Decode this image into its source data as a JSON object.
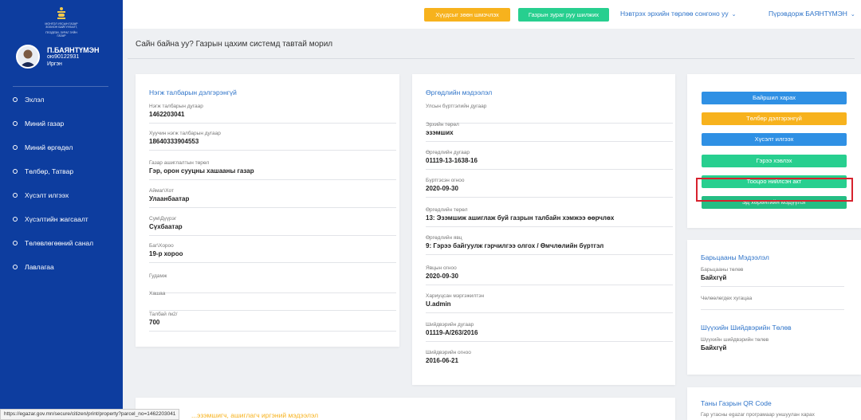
{
  "sidebar": {
    "logo_text": [
      "МОНГОЛ УЛСЫН ГАЗАР ЗОХИОН БАЙГУУЛАЛТ,",
      "ГЕОДЕЗИ, ЗУРАГ ЗҮЙН ГАЗАР"
    ],
    "user": {
      "name": "П.БАЯНТҮМЭН",
      "id": "ою90122931",
      "role": "Иргэн"
    },
    "items": [
      {
        "label": "Эхлэл"
      },
      {
        "label": "Миний газар"
      },
      {
        "label": "Миний өргөдөл"
      },
      {
        "label": "Төлбөр, Татвар"
      },
      {
        "label": "Хүсэлт илгээх"
      },
      {
        "label": "Хүсэлтийн жагсаалт"
      },
      {
        "label": "Төлөвлөгөөний санал"
      },
      {
        "label": "Лавлагаа"
      }
    ]
  },
  "topbar": {
    "request_btn": "Хүүдсыг зөөн шмэчлэх",
    "map_btn": "Газрын зураг руу шилжих",
    "role_select": "Нэвтрэх эрхийн төрлөө сонгоно уу",
    "user_menu": "Пүрэвдорж БАЯНТҮМЭН"
  },
  "welcome": "Сайн байна уу? Газрын цахим системд тавтай морил",
  "parcel": {
    "title": "Нэгж талбарын дэлгэрэнгүй",
    "fields": [
      {
        "label": "Нэгж талбарын дугаар",
        "value": "1462203041"
      },
      {
        "label": "Хуучин нэгж талбарын дугаар",
        "value": "18640333904553"
      },
      {
        "label": "Газар ашиглалтын төрөл",
        "value": "Гэр, орон сууцны хашааны газар"
      },
      {
        "label": "Аймаг\\Хот",
        "value": "Улаанбаатар"
      },
      {
        "label": "Сум\\Дүүрэг",
        "value": "Сүхбаатар"
      },
      {
        "label": "Баг\\Хороо",
        "value": "19-р хороо"
      },
      {
        "label": "Гудамж",
        "value": ""
      },
      {
        "label": "Хашаа",
        "value": ""
      },
      {
        "label": "Талбай /м2/",
        "value": "700"
      }
    ]
  },
  "application": {
    "title": "Өргөдлийн мэдээлэл",
    "fields": [
      {
        "label": "Улсын бүртгэлийн дугаар",
        "value": ""
      },
      {
        "label": "Эрхийн төрөл",
        "value": "эзэмших"
      },
      {
        "label": "Өргөдлийн дугаар",
        "value": "01119-13-1638-16"
      },
      {
        "label": "Бүртгэсэн огноо",
        "value": "2020-09-30"
      },
      {
        "label": "Өргөдлийн төрөл",
        "value": "13: Эзэмшиж ашиглаж буй газрын талбайн хэмжээ өөрчлөх"
      },
      {
        "label": "Өргөдлийн явц",
        "value": "9: Гэрээ байгуулж гэрчилгээ олгох / Өмчлөлийн бүртгэл"
      },
      {
        "label": "Явцын огноо",
        "value": "2020-09-30"
      },
      {
        "label": "Хариуцсан мэргэжилтэн",
        "value": "U.admin"
      },
      {
        "label": "Шийдвэрийн дугаар",
        "value": "01119-А/263/2016"
      },
      {
        "label": "Шийдвэрийн огноо",
        "value": "2016-06-21"
      }
    ]
  },
  "actions": [
    {
      "label": "Байршил харах",
      "color": "blue"
    },
    {
      "label": "Төлбөр дэлгэрэнгүй",
      "color": "orange"
    },
    {
      "label": "Хүсэлт илгээх",
      "color": "blue"
    },
    {
      "label": "Гэрээ хэвлэх",
      "color": "green"
    },
    {
      "label": "Тооцоо нийлсэн акт",
      "color": "green"
    },
    {
      "label": "Эд хөрөнгийн мэдүүлэг",
      "color": "green"
    }
  ],
  "mortgage": {
    "title": "Барьцааны Мэдээлэл",
    "status_label": "Барьцааны төлөв",
    "status_value": "Байхгүй",
    "expiry_label": "Чөлөөлөгдөх хугацаа"
  },
  "court": {
    "title": "Шүүхийн Шийдвэрийн Төлөв",
    "status_label": "Шүүхийн шийдвэрийн төлөв",
    "status_value": "Байхгүй"
  },
  "qr": {
    "title": "Таны Газрын QR Code",
    "hint": "Гар утасны egazar програмаар уншуулан харах"
  },
  "bottom_card_title": "...эзэмшигч, ашиглагч иргэний мэдээлэл",
  "status_url": "https://egazar.gov.mn/secure/citizen/print/property?parcel_no=1462203041",
  "colors": {
    "sidebar": "#0d3d9f",
    "blue": "#2f90e4",
    "orange": "#f7b21d",
    "green": "#27cf8f",
    "highlight": "#d7222e"
  }
}
